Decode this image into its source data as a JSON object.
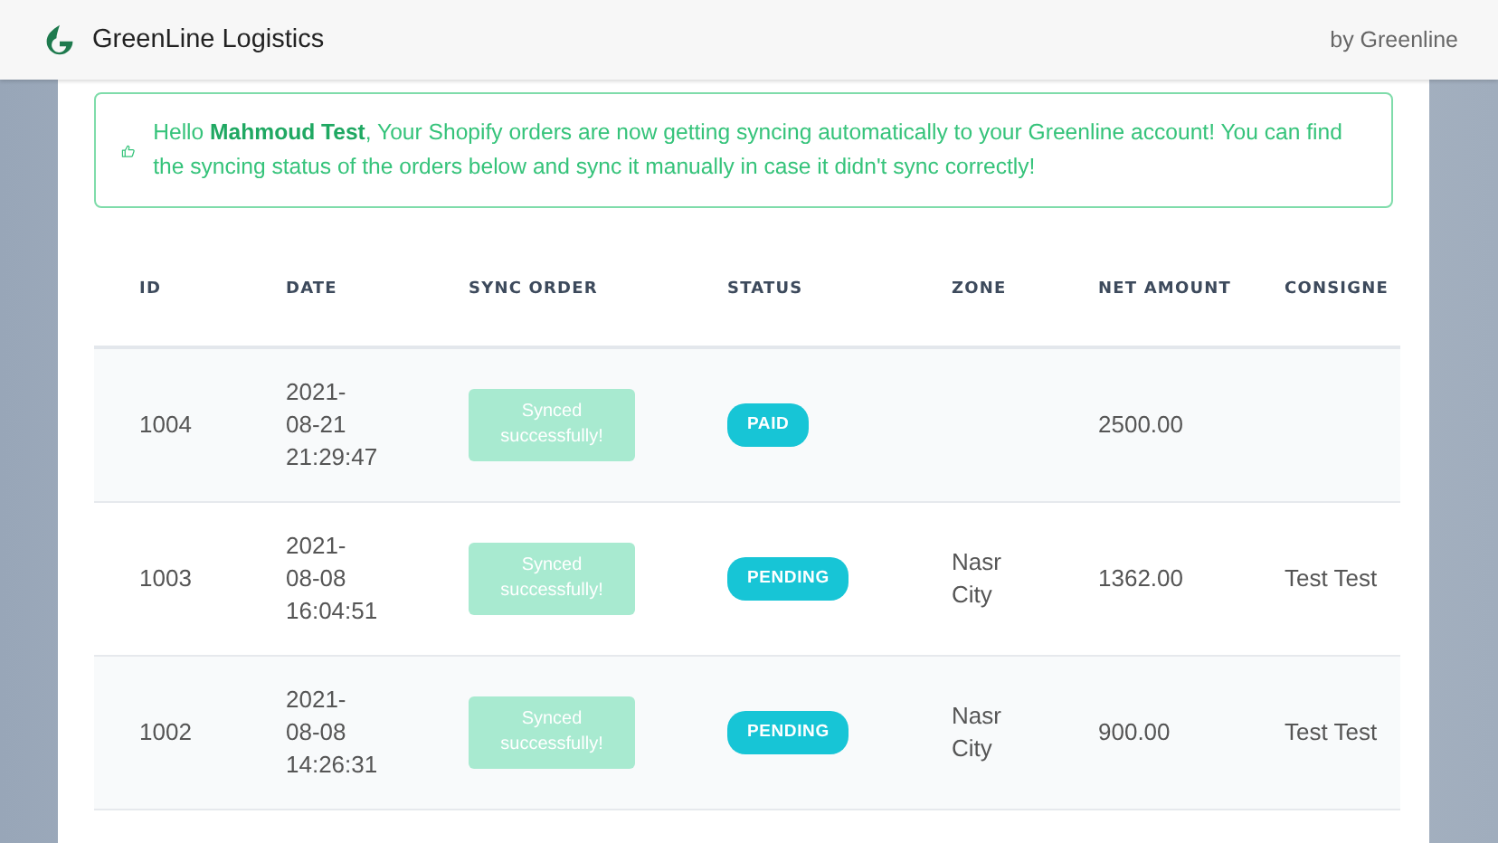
{
  "header": {
    "title": "GreenLine Logistics",
    "byline": "by Greenline"
  },
  "alert": {
    "text": "Hello **Mahmoud Test**, Your Shopify orders are now getting syncing automatically to your Greenline account! You can find the syncing status of the orders below and sync it manually in case it didn't sync correctly!"
  },
  "table": {
    "columns": [
      "ID",
      "DATE",
      "SYNC ORDER",
      "STATUS",
      "ZONE",
      "NET AMOUNT",
      "CONSIGNE"
    ],
    "rows": [
      {
        "id": "1004",
        "date": "2021-08-21 21:29:47",
        "sync": {
          "label": "Synced successfully!",
          "disabled": true
        },
        "status": "PAID",
        "zone": "",
        "net_amount": "2500.00",
        "consignee": ""
      },
      {
        "id": "1003",
        "date": "2021-08-08 16:04:51",
        "sync": {
          "label": "Synced successfully!",
          "disabled": true
        },
        "status": "PENDING",
        "zone": "Nasr City",
        "net_amount": "1362.00",
        "consignee": "Test Test"
      },
      {
        "id": "1002",
        "date": "2021-08-08 14:26:31",
        "sync": {
          "label": "Synced successfully!",
          "disabled": true
        },
        "status": "PENDING",
        "zone": "Nasr City",
        "net_amount": "900.00",
        "consignee": "Test Test"
      }
    ]
  }
}
